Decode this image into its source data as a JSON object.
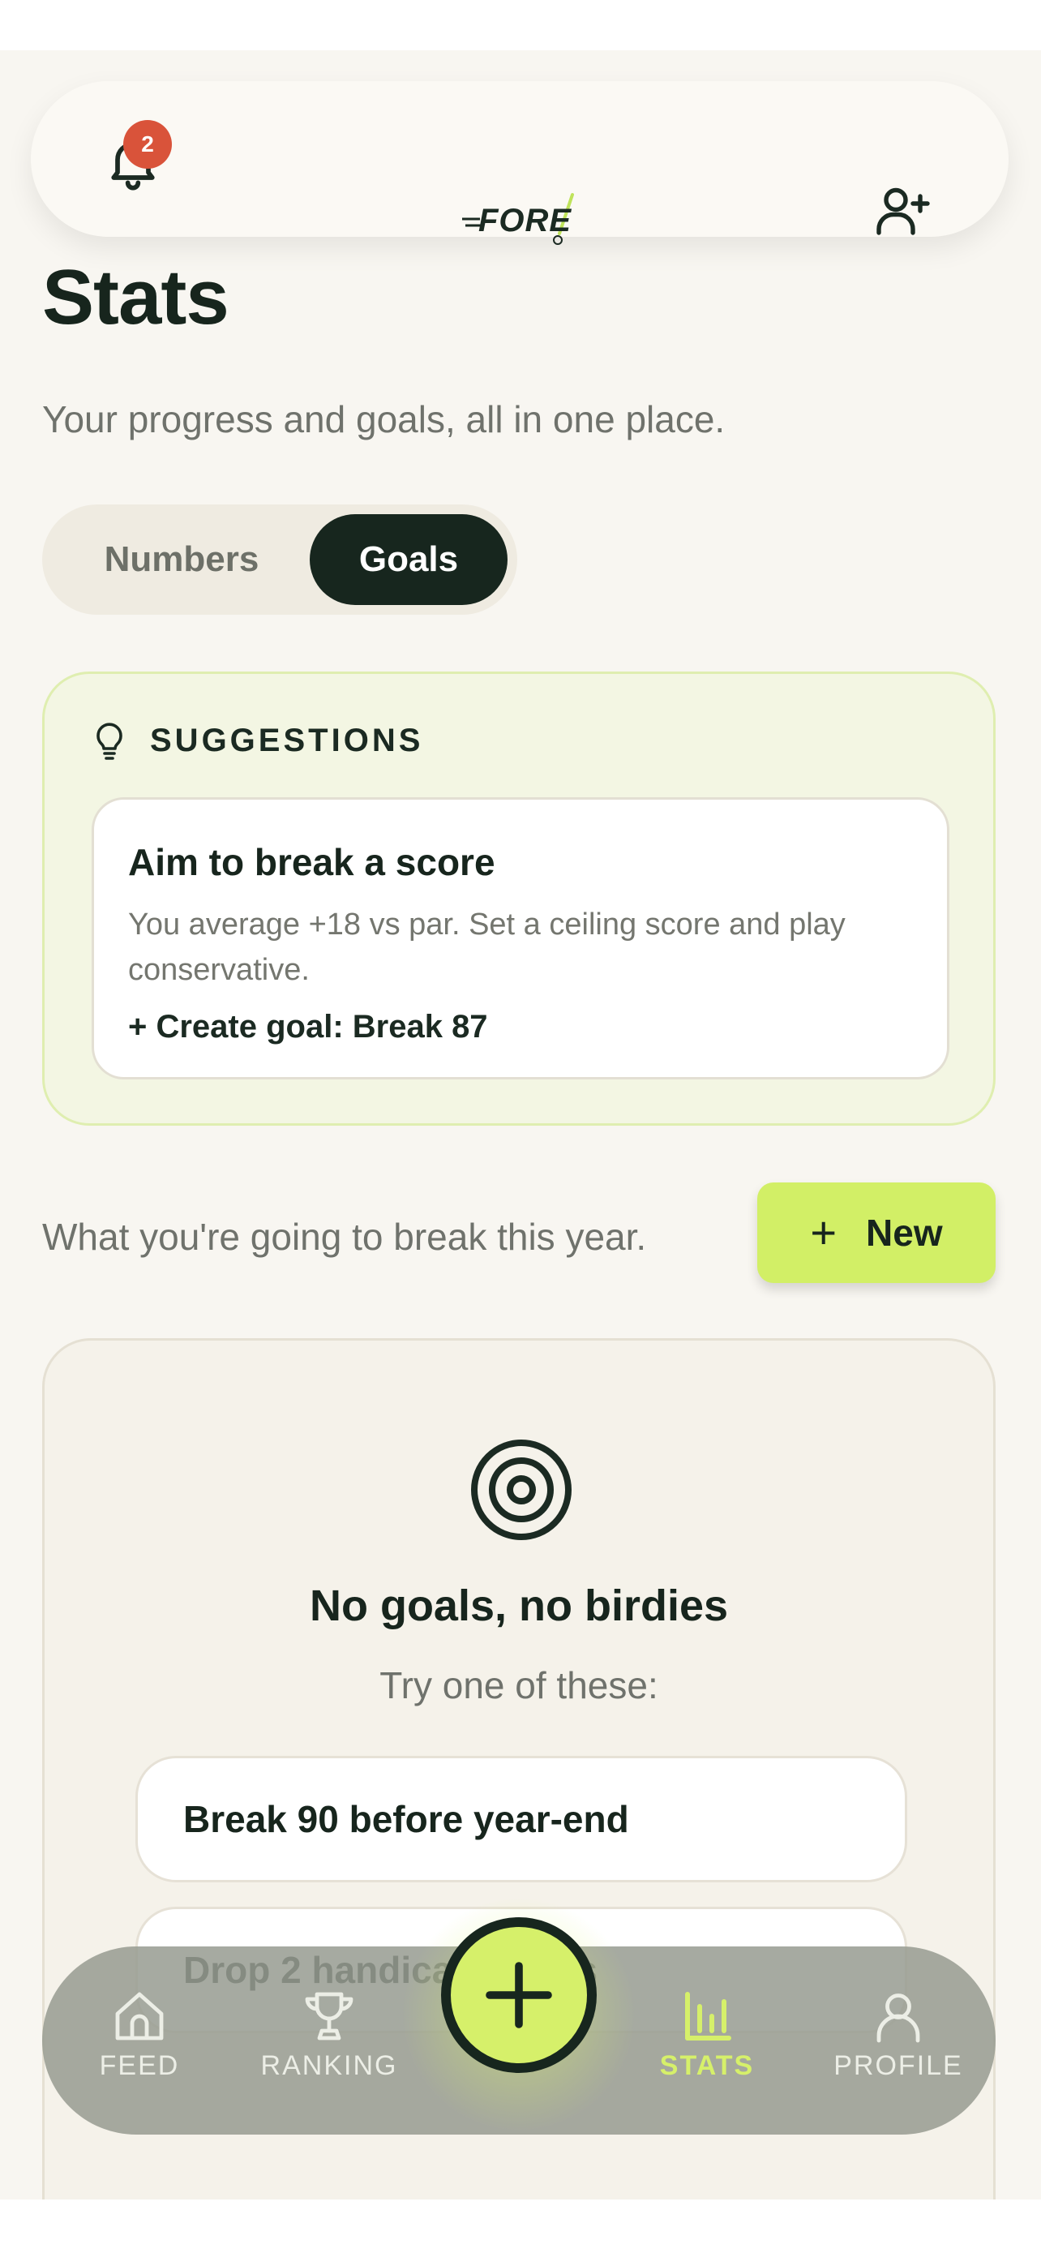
{
  "header": {
    "notifications_count": "2",
    "logo_text": "FORE"
  },
  "page": {
    "title": "Stats",
    "subtitle": "Your progress and goals, all in one place."
  },
  "tabs": [
    {
      "label": "Numbers",
      "active": false
    },
    {
      "label": "Goals",
      "active": true
    }
  ],
  "suggestions": {
    "label": "SUGGESTIONS",
    "card": {
      "title": "Aim to break a score",
      "description": "You average +18 vs par. Set a ceiling score and play conservative.",
      "action": "+ Create goal: Break 87"
    }
  },
  "goals": {
    "caption": "What you're going to break this year.",
    "new_label": "New"
  },
  "empty_state": {
    "title": "No goals, no birdies",
    "subtitle": "Try one of these:",
    "ideas": [
      "Break 90 before year-end",
      "Drop 2 handicap points"
    ]
  },
  "nav": {
    "items": [
      {
        "label": "FEED",
        "icon": "home-icon"
      },
      {
        "label": "RANKING",
        "icon": "trophy-icon"
      },
      {
        "label": "STATS",
        "icon": "bar-chart-icon",
        "active": true
      },
      {
        "label": "PROFILE",
        "icon": "user-icon"
      }
    ]
  },
  "colors": {
    "accent": "#d6f06a",
    "dark": "#17261e",
    "badge": "#d9533a",
    "background": "#f8f6f1"
  }
}
